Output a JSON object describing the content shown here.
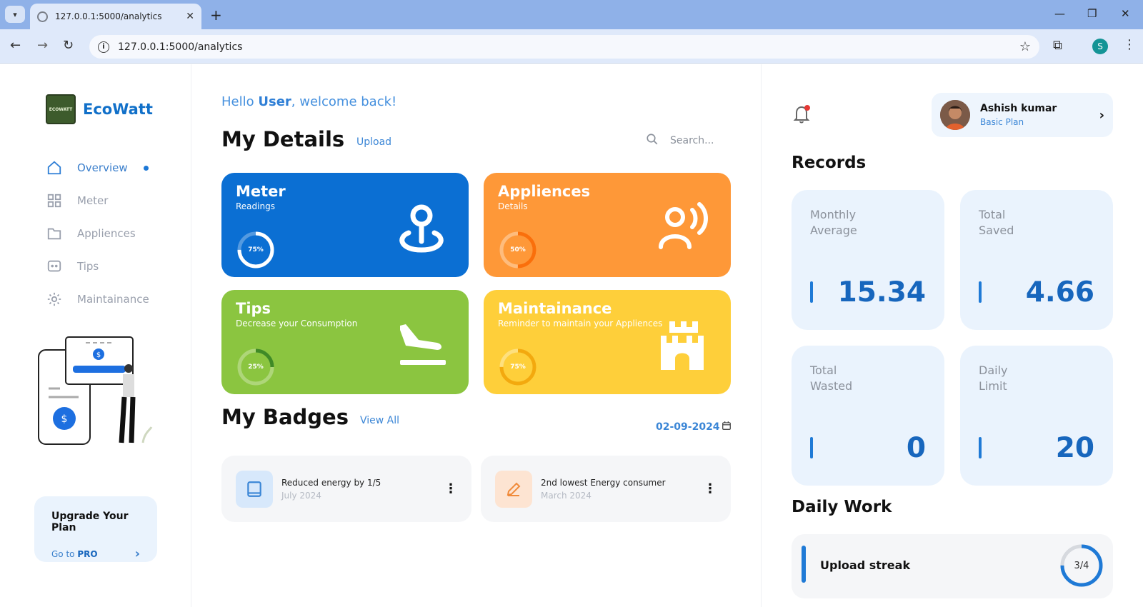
{
  "browser": {
    "tab_title": "127.0.0.1:5000/analytics",
    "url": "127.0.0.1:5000/analytics",
    "profile_initial": "S"
  },
  "sidebar": {
    "brand": "EcoWatt",
    "logo_text": "ECOWATT",
    "items": [
      {
        "label": "Overview",
        "icon": "home-icon",
        "active": true
      },
      {
        "label": "Meter",
        "icon": "grid-icon",
        "active": false
      },
      {
        "label": "Appliences",
        "icon": "folder-icon",
        "active": false
      },
      {
        "label": "Tips",
        "icon": "chat-icon",
        "active": false
      },
      {
        "label": "Maintainance",
        "icon": "gear-icon",
        "active": false
      }
    ],
    "upgrade": {
      "title": "Upgrade Your Plan",
      "link_prefix": "Go to",
      "link_bold": "PRO"
    }
  },
  "main": {
    "greeting_prefix": "Hello",
    "greeting_user": "User",
    "greeting_suffix": ", welcome back!",
    "details_title": "My Details",
    "upload_label": "Upload",
    "search_placeholder": "Search...",
    "cards": [
      {
        "title": "Meter",
        "subtitle": "Readings",
        "progress": 75,
        "progress_label": "75%",
        "color": "#0b6fd3",
        "icon": "location-pin-icon"
      },
      {
        "title": "Appliences",
        "subtitle": "Details",
        "progress": 50,
        "progress_label": "50%",
        "color": "#fe9838",
        "icon": "user-voice-icon"
      },
      {
        "title": "Tips",
        "subtitle": "Decrease your Consumption",
        "progress": 25,
        "progress_label": "25%",
        "color": "#8bc540",
        "icon": "plane-landing-icon"
      },
      {
        "title": "Maintainance",
        "subtitle": "Reminder to maintain your Appliences",
        "progress": 75,
        "progress_label": "75%",
        "color": "#fecf3a",
        "icon": "castle-icon"
      }
    ],
    "badges_title": "My Badges",
    "view_all_label": "View All",
    "date": "02-09-2024",
    "badges": [
      {
        "title": "Reduced energy by 1/5",
        "date": "July 2024",
        "icon": "book-icon"
      },
      {
        "title": "2nd lowest Energy consumer",
        "date": "March 2024",
        "icon": "pencil-icon"
      }
    ]
  },
  "right": {
    "profile": {
      "name": "Ashish kumar",
      "plan": "Basic Plan"
    },
    "records_title": "Records",
    "records": [
      {
        "label_line1": "Monthly",
        "label_line2": "Average",
        "value": "15.34"
      },
      {
        "label_line1": "Total",
        "label_line2": "Saved",
        "value": "4.66"
      },
      {
        "label_line1": "Total",
        "label_line2": "Wasted",
        "value": "0"
      },
      {
        "label_line1": "Daily",
        "label_line2": "Limit",
        "value": "20"
      }
    ],
    "daily_work_title": "Daily Work",
    "daily_work": {
      "label": "Upload streak",
      "value": "3/4",
      "done": 3,
      "total": 4
    }
  }
}
